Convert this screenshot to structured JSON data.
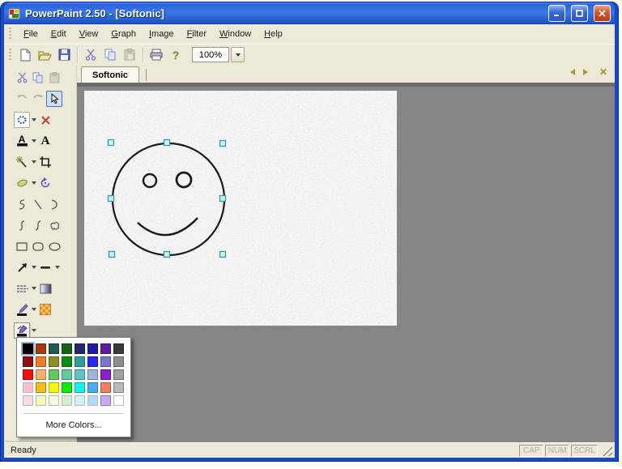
{
  "titlebar": {
    "title": "PowerPaint 2.50 - [Softonic]"
  },
  "menubar": {
    "items": [
      "File",
      "Edit",
      "View",
      "Graph",
      "Image",
      "Filter",
      "Window",
      "Help"
    ]
  },
  "toolbar": {
    "buttons": [
      "new",
      "open",
      "save",
      "cut",
      "copy",
      "paste",
      "print",
      "help"
    ],
    "help_glyph": "?",
    "zoom_value": "100%"
  },
  "tabbar": {
    "active_tab": "Softonic"
  },
  "toolbox": {
    "font_glyph": "A",
    "text_glyph": "A",
    "tools": [
      "cut",
      "copy",
      "paste",
      "undo",
      "redo",
      "select-pointer",
      "marquee",
      "delete",
      "font-color",
      "text",
      "magic-wand",
      "crop",
      "eraser",
      "rotate",
      "freehand",
      "line",
      "arc",
      "curve",
      "curve-2",
      "closed-curve",
      "rectangle",
      "rounded-rectangle",
      "ellipse",
      "arrow",
      "dash-line",
      "pattern",
      "gradient",
      "pen-color",
      "texture",
      "fill-color"
    ]
  },
  "palette": {
    "selected_index": 0,
    "rows": [
      [
        "#000000",
        "#a33a10",
        "#1e5a50",
        "#156415",
        "#26266e",
        "#1d1da0",
        "#5a1ea0",
        "#3a3a3a"
      ],
      [
        "#8e1010",
        "#f07b28",
        "#8e8e28",
        "#0e8e0e",
        "#2e9e9e",
        "#2828f0",
        "#7878c8",
        "#8e8e8e"
      ],
      [
        "#f01010",
        "#f5b06e",
        "#62c862",
        "#5ecc96",
        "#5cc4c4",
        "#9eb4dc",
        "#8e1ec8",
        "#a0a0a0"
      ],
      [
        "#f8c0cc",
        "#f0c018",
        "#f8f800",
        "#10e810",
        "#18f0f0",
        "#48b0f0",
        "#f08060",
        "#b8b8b8"
      ],
      [
        "#f8dce4",
        "#f8f8b8",
        "#f8f8dc",
        "#d0f0d0",
        "#ccf4f4",
        "#b4d8f8",
        "#c8a8f8",
        "#ffffff"
      ]
    ],
    "more_label": "More Colors..."
  },
  "statusbar": {
    "message": "Ready",
    "keys": [
      "CAP",
      "NUM",
      "SCRL"
    ]
  },
  "colors": {
    "chrome": "#ece9d8",
    "workspace": "#858585",
    "titlebar_blue": "#2a62d8",
    "handle_fill": "#cfeff0",
    "handle_border": "#2f9ea8"
  }
}
